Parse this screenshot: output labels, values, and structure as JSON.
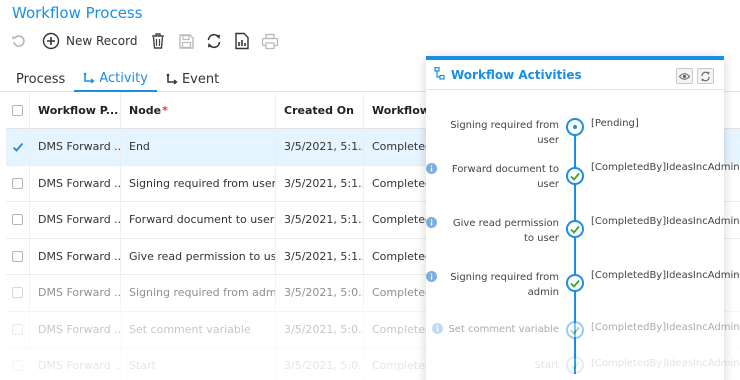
{
  "app": {
    "title": "Workflow Process"
  },
  "toolbar": {
    "undo_icon": "undo-icon",
    "new_record_label": "New Record",
    "delete_icon": "trash-icon",
    "save_icon": "save-icon",
    "refresh_icon": "refresh-icon",
    "report_icon": "report-icon",
    "print_icon": "print-icon"
  },
  "tabs": [
    {
      "label": "Process",
      "active": false
    },
    {
      "label": "Activity",
      "active": true
    },
    {
      "label": "Event",
      "active": false
    }
  ],
  "grid": {
    "columns": [
      "Workflow P...",
      "Node",
      "Created On",
      "Workflow S"
    ],
    "required_marker": "*",
    "rows": [
      {
        "selected": true,
        "workflow": "DMS Forward ...",
        "node": "End",
        "created": "3/5/2021, 5:1...",
        "status": "Completed"
      },
      {
        "selected": false,
        "workflow": "DMS Forward ...",
        "node": "Signing required from user",
        "created": "3/5/2021, 5:1...",
        "status": "Completed"
      },
      {
        "selected": false,
        "workflow": "DMS Forward ...",
        "node": "Forward document to user",
        "created": "3/5/2021, 5:1...",
        "status": "Completed"
      },
      {
        "selected": false,
        "workflow": "DMS Forward ...",
        "node": "Give read permission to user",
        "created": "3/5/2021, 5:1...",
        "status": "Completed"
      },
      {
        "selected": false,
        "workflow": "DMS Forward ...",
        "node": "Signing required from admin",
        "created": "3/5/2021, 5:0...",
        "status": "Completed"
      },
      {
        "selected": false,
        "workflow": "DMS Forward ...",
        "node": "Set comment variable",
        "created": "3/5/2021, 5:0...",
        "status": "Completed"
      },
      {
        "selected": false,
        "workflow": "DMS Forward ...",
        "node": "Start",
        "created": "3/5/2021, 5:0...",
        "status": "Completed"
      }
    ]
  },
  "panel": {
    "title": "Workflow Activities",
    "accent": "#1a8fe0",
    "activities": [
      {
        "label": "Signing required from user",
        "status": "[Pending]",
        "state": "pending",
        "info": false
      },
      {
        "label": "Forward document to user",
        "status": "[CompletedBy]IdeasIncAdmin",
        "state": "done",
        "info": true
      },
      {
        "label": "Give read permission to user",
        "status": "[CompletedBy]IdeasIncAdmin",
        "state": "done",
        "info": true
      },
      {
        "label": "Signing required from admin",
        "status": "[CompletedBy]IdeasIncAdmin",
        "state": "done",
        "info": true
      },
      {
        "label": "Set comment variable",
        "status": "[CompletedBy]IdeasIncAdmin",
        "state": "done",
        "info": true
      },
      {
        "label": "Start",
        "status": "[CompletedBy]IdeasIncAdmin",
        "state": "done",
        "info": false
      }
    ]
  }
}
